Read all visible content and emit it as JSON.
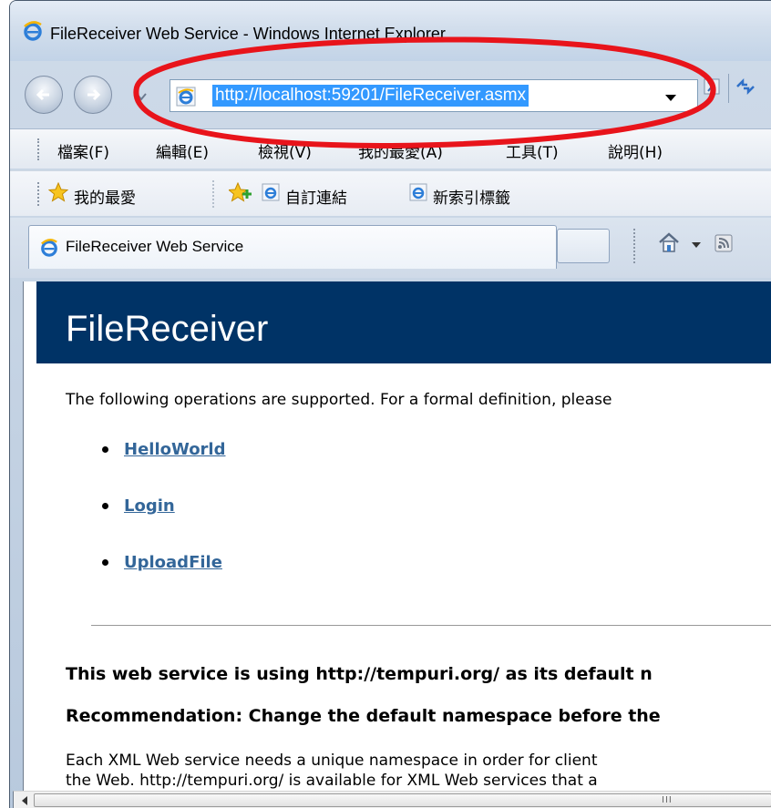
{
  "window": {
    "title": "FileReceiver Web Service - Windows Internet Explorer"
  },
  "address_bar": {
    "url": "http://localhost:59201/FileReceiver.asmx"
  },
  "menu": {
    "items": [
      "檔案(F)",
      "編輯(E)",
      "檢視(V)",
      "我的最愛(A)",
      "工具(T)",
      "說明(H)"
    ]
  },
  "favorites_bar": {
    "favorites_label": "我的最愛",
    "links": [
      "自訂連結",
      "新索引標籤"
    ]
  },
  "tabs": {
    "active_label": "FileReceiver Web Service"
  },
  "page": {
    "title": "FileReceiver",
    "intro": "The following operations are supported. For a formal definition, please",
    "operations": [
      "HelloWorld",
      "Login",
      "UploadFile"
    ],
    "namespace_note": "This web service is using http://tempuri.org/ as its default n",
    "recommendation": "Recommendation: Change the default namespace before the",
    "paragraph_lines": [
      "Each XML Web service needs a unique namespace in order for client",
      "the Web. http://tempuri.org/ is available for XML Web services that a"
    ]
  },
  "scrollbar": {
    "grip": "III"
  },
  "colors": {
    "header_band": "#003366",
    "link": "#336699",
    "selection": "#3399ff",
    "annotation": "#e8141b"
  },
  "icons": [
    "ie-logo-icon",
    "back-arrow-icon",
    "forward-arrow-icon",
    "chevron-down-icon",
    "compatibility-view-icon",
    "refresh-icon",
    "favorites-star-icon",
    "add-favorite-icon",
    "home-icon",
    "feeds-icon"
  ]
}
